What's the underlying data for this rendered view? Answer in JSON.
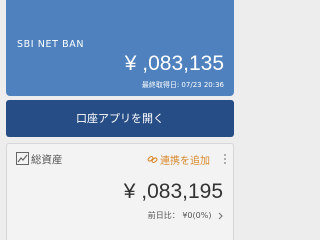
{
  "account_card": {
    "bank_name": "SBI  NET  BAN",
    "balance": "¥ ,083,135",
    "last_updated": "最終取得日: 07/23 20:36"
  },
  "open_app_button": {
    "label": "口座アプリを開く"
  },
  "total_assets": {
    "title": "総資産",
    "link_label": "連携を追加",
    "amount": "¥ ,083,195",
    "change_label": "前日比：",
    "change_value": "¥0(0%)"
  },
  "colors": {
    "account_card_bg": "#4e81be",
    "button_bg": "#264d85",
    "link_accent": "#d98a2e",
    "page_bg": "#ededed"
  },
  "icons": {
    "chart": "line-chart-icon",
    "link": "link-icon",
    "menu": "more-vertical-icon",
    "chevron": "chevron-right-icon"
  }
}
